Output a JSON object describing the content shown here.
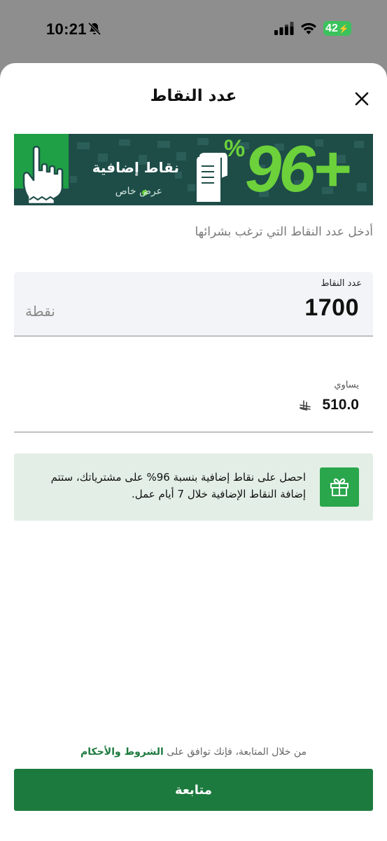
{
  "status_bar": {
    "time": "10:21",
    "battery": "42"
  },
  "sheet": {
    "title": "عدد النقاط"
  },
  "banner": {
    "big_number": "96+",
    "percent_sign": "%",
    "title": "نقاط إضافية",
    "subtitle": "عرض خاص"
  },
  "prompt": "أدخل عدد النقاط التي ترغب بشرائها",
  "points_field": {
    "label": "عدد النقاط",
    "value": "1700",
    "unit": "نقطة"
  },
  "equals_field": {
    "label": "يساوي",
    "value": "510.0"
  },
  "info": {
    "text": "احصل على نقاط إضافية بنسبة 96% على مشترياتك، ستتم إضافة النقاط الإضافية خلال 7 أيام عمل."
  },
  "terms": {
    "prefix": "من خلال المتابعة، فإنك توافق على ",
    "link": "الشروط والأحكام"
  },
  "continue_label": "متابعة",
  "colors": {
    "primary": "#1d7a3e",
    "banner_bg": "#1e4d48",
    "banner_accent": "#6cd13a",
    "info_bg": "#e3efe6"
  }
}
